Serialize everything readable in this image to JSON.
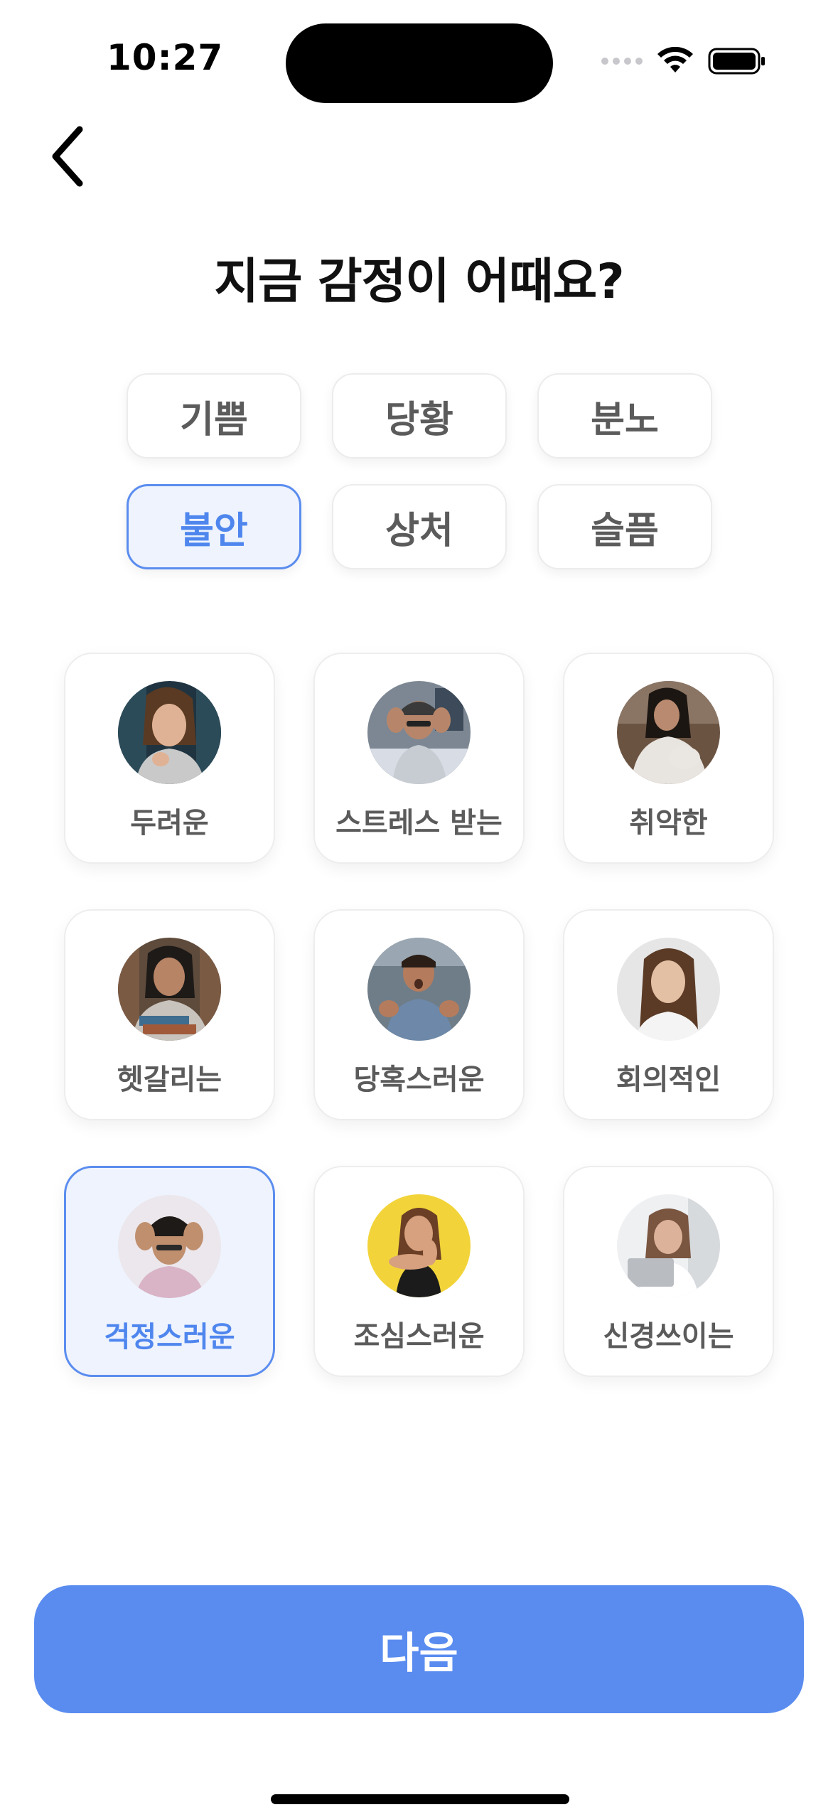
{
  "status_bar": {
    "time": "10:27"
  },
  "header": {
    "back_icon": "chevron-left-icon",
    "title": "지금 감정이 어때요?"
  },
  "categories": [
    {
      "label": "기쁨",
      "selected": false
    },
    {
      "label": "당황",
      "selected": false
    },
    {
      "label": "분노",
      "selected": false
    },
    {
      "label": "불안",
      "selected": true
    },
    {
      "label": "상처",
      "selected": false
    },
    {
      "label": "슬픔",
      "selected": false
    }
  ],
  "emotions": [
    {
      "label": "두려운",
      "selected": false
    },
    {
      "label": "스트레스 받는",
      "selected": false
    },
    {
      "label": "취약한",
      "selected": false
    },
    {
      "label": "헷갈리는",
      "selected": false
    },
    {
      "label": "당혹스러운",
      "selected": false
    },
    {
      "label": "회의적인",
      "selected": false
    },
    {
      "label": "걱정스러운",
      "selected": true
    },
    {
      "label": "조심스러운",
      "selected": false
    },
    {
      "label": "신경쓰이는",
      "selected": false
    }
  ],
  "footer": {
    "next_label": "다음"
  },
  "colors": {
    "accent": "#5a8cf0",
    "selected_bg": "#eef3fd",
    "selected_border": "#5b8def",
    "text_muted": "#5b5b5b"
  }
}
